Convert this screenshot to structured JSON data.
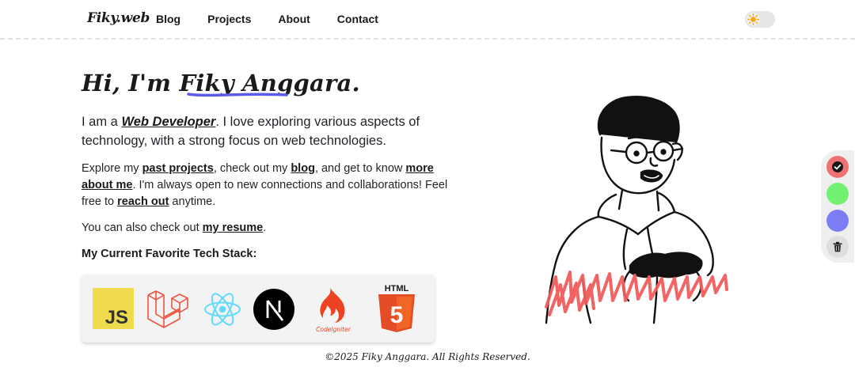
{
  "header": {
    "logo": "Fiky.web",
    "nav": [
      "Blog",
      "Projects",
      "About",
      "Contact"
    ],
    "theme_toggle_icon": "sun-icon"
  },
  "hero": {
    "greeting_prefix": "Hi, I'm ",
    "name": "Fiky Anggara",
    "greeting_suffix": ".",
    "intro_prefix": "I am a ",
    "role": "Web Developer",
    "intro_suffix": ". I love exploring various aspects of technology, with a strong focus on web technologies.",
    "explore": {
      "t1": "Explore my ",
      "link_projects": "past projects",
      "t2": ", check out my ",
      "link_blog": "blog",
      "t3": ", and get to know ",
      "link_about": "more about me",
      "t4": ". I'm always open to new connections and collaborations! Feel free to ",
      "link_reach": "reach out",
      "t5": " anytime."
    },
    "resume": {
      "t1": "You can also check out ",
      "link": "my resume",
      "t2": "."
    }
  },
  "stack": {
    "heading": "My Current Favorite Tech Stack:",
    "items": [
      {
        "name": "javascript-icon",
        "label": "JS",
        "color": "#F0DB4F"
      },
      {
        "name": "laravel-icon",
        "color": "#F05340"
      },
      {
        "name": "react-icon",
        "color": "#61DAFB"
      },
      {
        "name": "nextjs-icon",
        "label": "N",
        "color": "#000000"
      },
      {
        "name": "codeigniter-icon",
        "label": "CodeIgniter",
        "color": "#EE4323"
      },
      {
        "name": "html5-icon",
        "label": "HTML",
        "label_num": "5",
        "color": "#E44D26"
      }
    ]
  },
  "palette": {
    "swatches": [
      {
        "name": "red-swatch",
        "color": "#F07171",
        "selected": true
      },
      {
        "name": "green-swatch",
        "color": "#72F072"
      },
      {
        "name": "blue-swatch",
        "color": "#7C7CF5"
      }
    ],
    "clear_icon": "trash-icon"
  },
  "colors": {
    "accent_underline": "#5B5BE8",
    "scribble": "#F25C5C"
  },
  "footer": "©2025 Fiky Anggara. All Rights Reserved."
}
